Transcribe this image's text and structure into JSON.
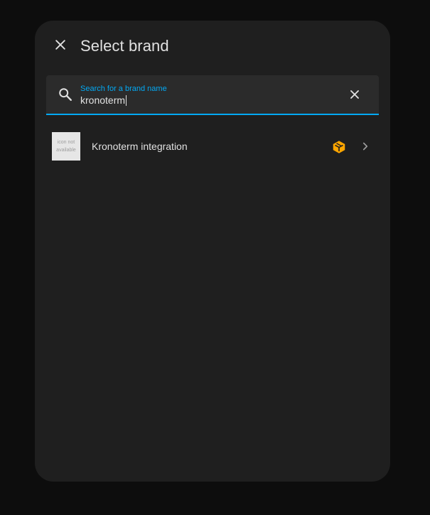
{
  "dialog": {
    "title": "Select brand",
    "close_icon": "close-icon"
  },
  "search": {
    "label": "Search for a brand name",
    "value": "kronoterm",
    "search_icon": "search-icon",
    "clear_icon": "close-icon"
  },
  "results": [
    {
      "name": "Kronoterm integration",
      "image_placeholder_line1": "icon not",
      "image_placeholder_line2": "available",
      "badge_icon": "custom-integration-icon",
      "arrow_icon": "chevron-right-icon"
    }
  ],
  "colors": {
    "background": "#0d0d0d",
    "dialog": "#1f1f1f",
    "search_field": "#2b2b2b",
    "accent": "#03a9f4",
    "text": "#e1e1e1",
    "badge": "#ffa600"
  }
}
